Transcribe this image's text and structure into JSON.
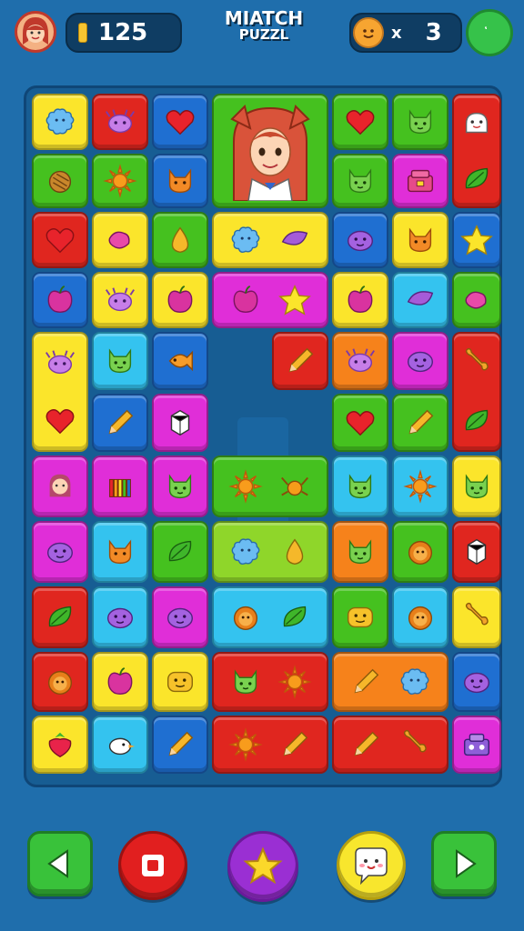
{
  "header": {
    "score": "125",
    "title_line1": "MIATCH",
    "title_line2": "PUZZL",
    "lives_multiplier": "x",
    "lives": "3",
    "menu_label": "҅҅҅"
  },
  "colors": {
    "background": "#1f6eac",
    "board": "#175d93",
    "yellow": "#fbe52b",
    "red": "#e0261f",
    "blue": "#1f6fd1",
    "green": "#45c11f",
    "magenta": "#e02ed8",
    "cyan": "#34c3ef",
    "orange": "#f6821b"
  },
  "board": {
    "tiles": [
      {
        "name": "tile-blue-fluff",
        "color": "yellow",
        "icons": [
          "fluff-icon"
        ]
      },
      {
        "name": "tile-purple-bug",
        "color": "red",
        "icons": [
          "bug-icon"
        ]
      },
      {
        "name": "tile-heart",
        "color": "blue",
        "icons": [
          "heart-icon"
        ]
      },
      {
        "name": "tile-girl-portrait",
        "color": "green",
        "icons": [
          "girl-portrait-icon"
        ]
      },
      {
        "name": "tile-green-heart",
        "color": "green",
        "icons": [
          "heart-icon"
        ]
      },
      {
        "name": "tile-green-cat",
        "color": "green",
        "icons": [
          "cat-icon"
        ]
      },
      {
        "name": "tile-ghost",
        "color": "red",
        "icons": [
          "ghost-icon"
        ]
      },
      {
        "name": "tile-coconut",
        "color": "green",
        "icons": [
          "nut-icon"
        ]
      },
      {
        "name": "tile-sun",
        "color": "green",
        "icons": [
          "sun-icon"
        ]
      },
      {
        "name": "tile-fox",
        "color": "blue",
        "icons": [
          "fox-icon"
        ]
      },
      {
        "name": "tile-green-cat-2",
        "color": "green",
        "icons": [
          "cat-icon"
        ]
      },
      {
        "name": "tile-chest",
        "color": "magenta",
        "icons": [
          "chest-icon"
        ]
      },
      {
        "name": "tile-leaf-shield",
        "color": "red",
        "icons": [
          "leaf-icon"
        ]
      }
    ]
  },
  "controls": {
    "back": "back-arrow-icon",
    "stop": "stop-icon",
    "star": "star-icon",
    "chat": "chat-face-icon",
    "forward": "forward-arrow-icon"
  }
}
